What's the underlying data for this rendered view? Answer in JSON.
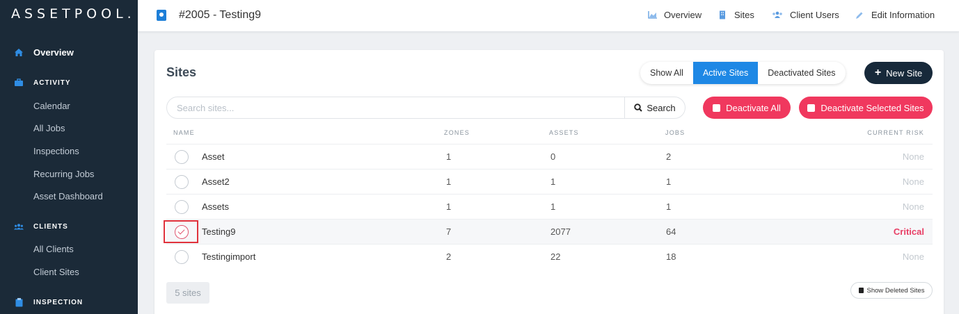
{
  "sidebar": {
    "logo": "ASSETPOOL.",
    "overview": "Overview",
    "activity": {
      "header": "ACTIVITY",
      "items": [
        "Calendar",
        "All Jobs",
        "Inspections",
        "Recurring Jobs",
        "Asset Dashboard"
      ]
    },
    "clients": {
      "header": "CLIENTS",
      "items": [
        "All Clients",
        "Client Sites"
      ]
    },
    "inspection": {
      "header": "INSPECTION"
    }
  },
  "header": {
    "title": "#2005 - Testing9",
    "links": [
      "Overview",
      "Sites",
      "Client Users",
      "Edit Information"
    ]
  },
  "card": {
    "title": "Sites",
    "filters": [
      "Show All",
      "Active Sites",
      "Deactivated Sites"
    ],
    "active_filter": "Active Sites",
    "new_site": "New Site",
    "search": {
      "placeholder": "Search sites...",
      "value": "",
      "button": "Search"
    },
    "deactivate_all": "Deactivate All",
    "deactivate_selected": "Deactivate Selected Sites",
    "columns": [
      "NAME",
      "ZONES",
      "ASSETS",
      "JOBS",
      "CURRENT RISK"
    ],
    "rows": [
      {
        "name": "Asset",
        "zones": "1",
        "assets": "0",
        "jobs": "2",
        "risk": "None",
        "selected": false
      },
      {
        "name": "Asset2",
        "zones": "1",
        "assets": "1",
        "jobs": "1",
        "risk": "None",
        "selected": false
      },
      {
        "name": "Assets",
        "zones": "1",
        "assets": "1",
        "jobs": "1",
        "risk": "None",
        "selected": false
      },
      {
        "name": "Testing9",
        "zones": "7",
        "assets": "2077",
        "jobs": "64",
        "risk": "Critical",
        "selected": true
      },
      {
        "name": "Testingimport",
        "zones": "2",
        "assets": "22",
        "jobs": "18",
        "risk": "None",
        "selected": false
      }
    ],
    "count": "5 sites",
    "show_deleted": "Show Deleted Sites"
  },
  "colors": {
    "sidebar_bg": "#1b2a38",
    "accent_blue": "#1e88e5",
    "danger": "#f0385e",
    "dark_button": "#17293a",
    "critical": "#e83e65"
  }
}
